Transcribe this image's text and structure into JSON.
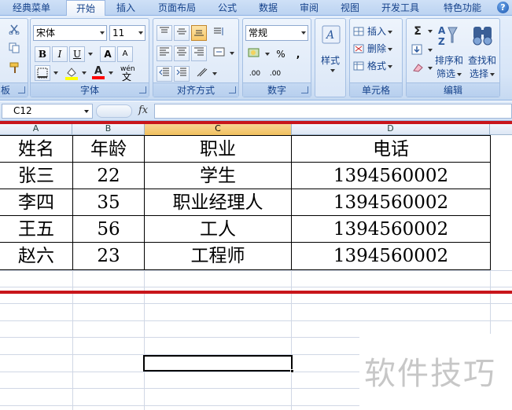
{
  "tabs": [
    "经典菜单",
    "开始",
    "插入",
    "页面布局",
    "公式",
    "数据",
    "审阅",
    "视图",
    "开发工具",
    "特色功能"
  ],
  "active_tab": "开始",
  "help_label": "?",
  "ribbon": {
    "clipboard": {
      "label": "板"
    },
    "font": {
      "label": "字体",
      "font_name": "宋体",
      "font_size": "11",
      "bold": "B",
      "italic": "I",
      "underline": "U",
      "grow": "A",
      "shrink": "A",
      "fill_color": "#ffff00",
      "font_color": "#ff0000",
      "phonetic": "wén",
      "phonetic_char": "文"
    },
    "alignment": {
      "label": "对齐方式"
    },
    "number": {
      "label": "数字",
      "format": "常规",
      "percent": "%",
      "comma": ",",
      "inc_decimal": ".00",
      "dec_decimal": ".00"
    },
    "styles": {
      "label": "样式"
    },
    "cells": {
      "label": "单元格",
      "insert": "插入",
      "delete": "删除",
      "format": "格式"
    },
    "editing": {
      "label": "编辑",
      "sum": "Σ",
      "sort_filter_1": "排序和",
      "sort_filter_2": "筛选",
      "find_select_1": "查找和",
      "find_select_2": "选择"
    }
  },
  "formula_bar": {
    "name_box": "C12",
    "fx": "fx",
    "formula": ""
  },
  "columns": [
    {
      "letter": "A",
      "selected": false
    },
    {
      "letter": "B",
      "selected": false
    },
    {
      "letter": "C",
      "selected": true
    },
    {
      "letter": "D",
      "selected": false
    }
  ],
  "table": {
    "headers": [
      "姓名",
      "年龄",
      "职业",
      "电话"
    ],
    "rows": [
      [
        "张三",
        "22",
        "学生",
        "1394560002"
      ],
      [
        "李四",
        "35",
        "职业经理人",
        "1394560002"
      ],
      [
        "王五",
        "56",
        "工人",
        "1394560002"
      ],
      [
        "赵六",
        "23",
        "工程师",
        "1394560002"
      ]
    ]
  },
  "watermark": "软件技巧",
  "colors": {
    "accent_red": "#c8151b",
    "selected_column": "#f1c15f"
  }
}
